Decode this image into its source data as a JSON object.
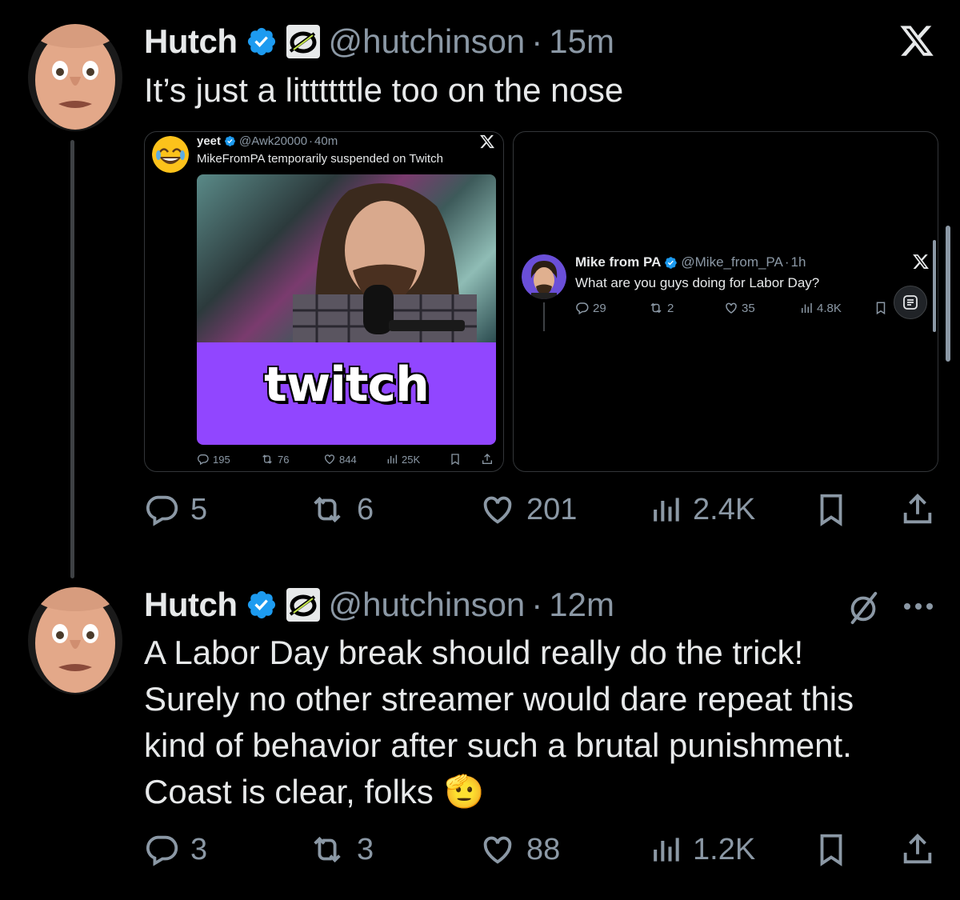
{
  "tweets": [
    {
      "name": "Hutch",
      "handle": "@hutchinson",
      "time": "15m",
      "text": "It’s just a littttttle too on the nose",
      "stats": {
        "replies": "5",
        "reposts": "6",
        "likes": "201",
        "views": "2.4K"
      }
    },
    {
      "name": "Hutch",
      "handle": "@hutchinson",
      "time": "12m",
      "text_lines": [
        "A Labor Day break should really do the trick!",
        "Surely no other streamer would dare repeat this",
        "kind of behavior after such a brutal punishment.",
        "Coast is clear, folks"
      ],
      "emoji": "🫡",
      "stats": {
        "replies": "3",
        "reposts": "3",
        "likes": "88",
        "views": "1.2K"
      }
    }
  ],
  "embeds": [
    {
      "name": "yeet",
      "handle": "@Awk20000",
      "time": "40m",
      "text": "MikeFromPA temporarily suspended on Twitch",
      "image_label": "twitch",
      "stats": {
        "replies": "195",
        "reposts": "76",
        "likes": "844",
        "views": "25K"
      }
    },
    {
      "name": "Mike from PA",
      "handle": "@Mike_from_PA",
      "time": "1h",
      "text": "What are you guys doing for Labor Day?",
      "stats": {
        "replies": "29",
        "reposts": "2",
        "likes": "35",
        "views": "4.8K"
      }
    }
  ],
  "sep": "·",
  "colors": {
    "verified": "#1d9bf0",
    "muted": "#8b98a5",
    "twitch": "#9146ff",
    "affiliate": "#c6e84a"
  },
  "icons": [
    "x-logo-icon",
    "verified-badge-icon",
    "affiliate-badge-icon",
    "reply-icon",
    "repost-icon",
    "like-icon",
    "views-icon",
    "bookmark-icon",
    "share-icon",
    "grok-slash-icon",
    "more-icon"
  ]
}
